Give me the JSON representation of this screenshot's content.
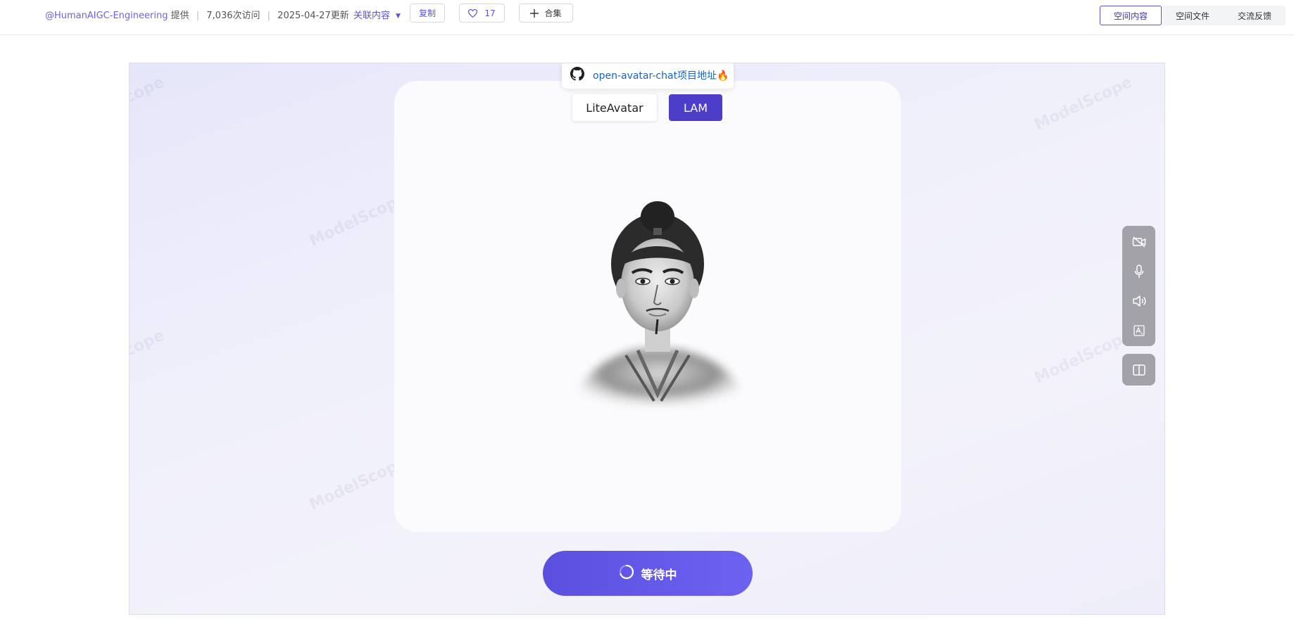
{
  "header": {
    "author": "@HumanAIGC-Engineering",
    "provided": "提供",
    "visits": "7,036次访问",
    "updated": "2025-04-27更新",
    "related": "关联内容",
    "copy": "复制",
    "likes": "17",
    "collect": "合集"
  },
  "nav": {
    "tabs": [
      "空间内容",
      "空间文件",
      "交流反馈"
    ],
    "active_tab": "空间内容"
  },
  "stage": {
    "repo_link": "open-avatar-chat项目地址🔥",
    "mode_tabs": [
      "LiteAvatar",
      "LAM"
    ],
    "active_mode": "LAM",
    "status_button": "等待中",
    "watermark": "ModelScope"
  },
  "colors": {
    "accent": "#5b54d6",
    "active_tab": "#4d3ec9",
    "wait_button": "#5b4fe0",
    "side_panel": "#a2a2a8"
  },
  "icons": {
    "repo": "github-icon",
    "side": [
      "camera-off-icon",
      "microphone-icon",
      "speaker-icon",
      "subtitle-icon",
      "book-icon"
    ],
    "like": "heart-icon",
    "collect": "plus-icon",
    "loading": "spinner-icon"
  }
}
